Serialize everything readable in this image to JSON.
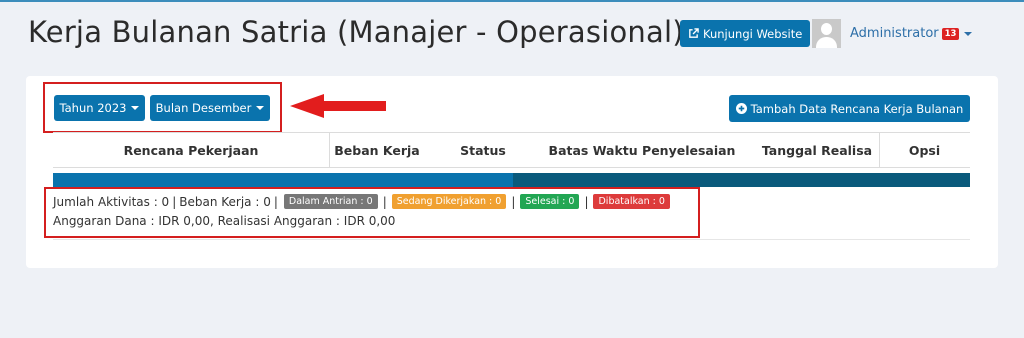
{
  "header": {
    "title": "Kerja Bulanan Satria (Manajer - Operasional)",
    "visit_button": "Kunjungi Website",
    "user_name": "Administrator",
    "notification_count": "13"
  },
  "filters": {
    "year_button": "Tahun 2023",
    "month_button": "Bulan Desember"
  },
  "actions": {
    "add_button": "Tambah Data Rencana Kerja Bulanan"
  },
  "table": {
    "columns": [
      "Rencana Pekerjaan",
      "Beban Kerja",
      "Status",
      "Batas Waktu Penyelesaian",
      "Tanggal Realisa",
      "Opsi"
    ]
  },
  "summary": {
    "activity_text": "Jumlah Aktivitas : 0",
    "workload_text": "Beban Kerja : 0",
    "separator": "|",
    "queued": "Dalam Antrian : 0",
    "in_progress": "Sedang Dikerjakan : 0",
    "done": "Selesai : 0",
    "cancelled": "Dibatalkan : 0",
    "budget_text": "Anggaran Dana : IDR 0,00, Realisasi Anggaran : IDR 0,00"
  },
  "colors": {
    "primary": "#0a73ad",
    "queued": "#777777",
    "in_progress": "#f0a030",
    "done": "#22a653",
    "cancelled": "#dd3b3b",
    "highlight": "#d41f1f"
  }
}
